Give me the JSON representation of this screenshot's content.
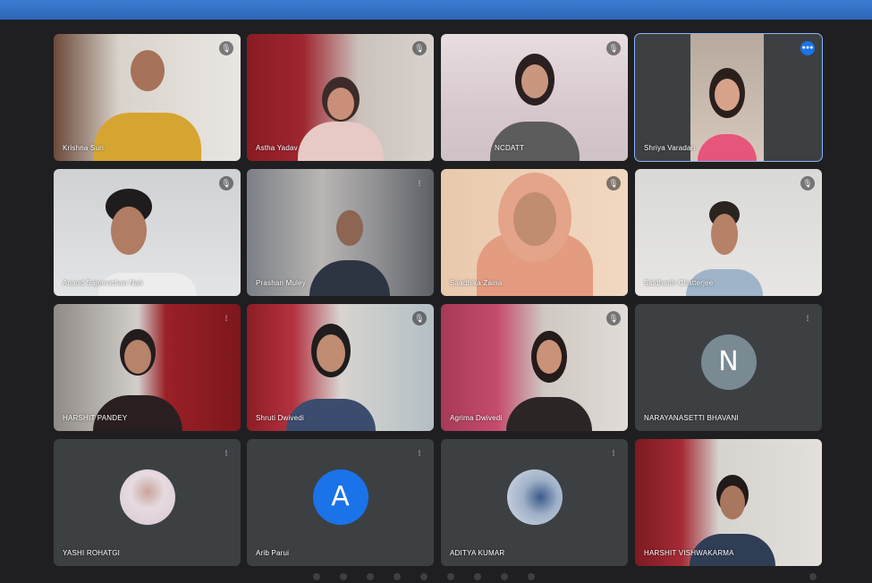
{
  "participants": [
    {
      "name": "Krishna Suri",
      "mic": "🎙"
    },
    {
      "name": "Astha Yadav",
      "mic": "🎙"
    },
    {
      "name": "NCDATT",
      "mic": "🎙"
    },
    {
      "name": "Shriya Varadan",
      "mic": "●●●"
    },
    {
      "name": "Anand Sajeevichan Nair",
      "mic": "🎙"
    },
    {
      "name": "Prashan Muley",
      "mic": "⁞"
    },
    {
      "name": "Saadhika Zaina",
      "mic": "🎙"
    },
    {
      "name": "Siddharth Chatterjee",
      "mic": "🎙"
    },
    {
      "name": "HARSHIT PANDEY",
      "mic": "⁞"
    },
    {
      "name": "Shruti Dwivedi",
      "mic": "🎙"
    },
    {
      "name": "Agrima Dwivedi",
      "mic": "🎙"
    },
    {
      "name": "NARAYANASETTI BHAVANI",
      "mic": "⁞",
      "initial": "N"
    },
    {
      "name": "YASHI ROHATGI",
      "mic": "⁞"
    },
    {
      "name": "Arib Parui",
      "mic": "⁞",
      "initial": "A"
    },
    {
      "name": "ADITYA KUMAR",
      "mic": "⁞"
    },
    {
      "name": "HARSHIT VISHWAKARMA",
      "mic": "⁞"
    }
  ],
  "colors": {
    "tile_bg": "#3c4043",
    "speaking_outline": "#8ab4f8",
    "avatar_N": "#7a8a93",
    "avatar_A": "#1a73e8"
  }
}
